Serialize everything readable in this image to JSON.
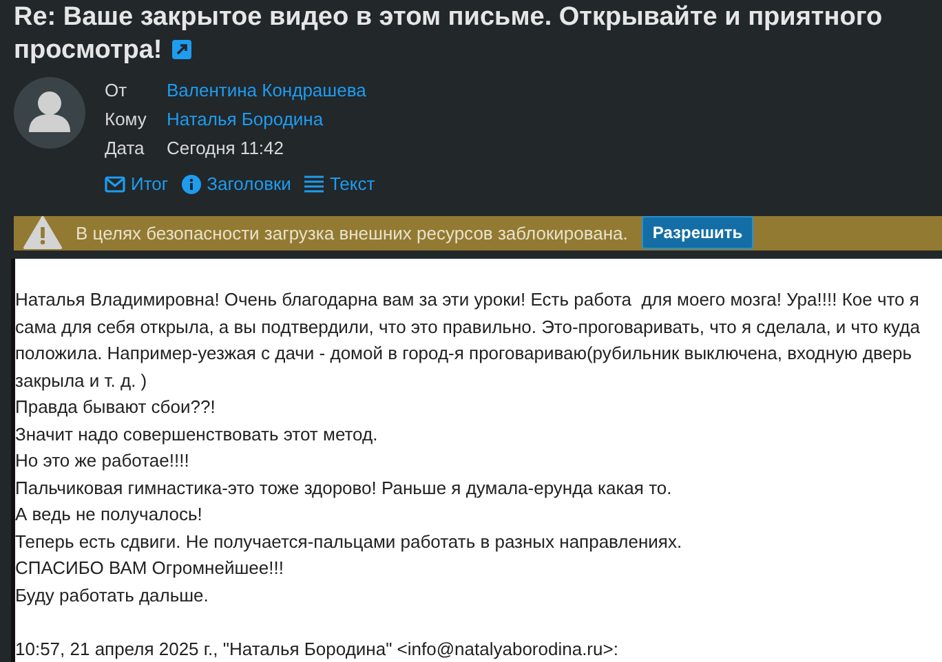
{
  "subject_lines": [
    "Re: Ваше закрытое видео в этом письме. Открывайте и приятного",
    "просмотра!"
  ],
  "header": {
    "fields": [
      {
        "label": "От",
        "value": "Валентина Кондрашева",
        "kind": "link"
      },
      {
        "label": "Кому",
        "value": "Наталья Бородина",
        "kind": "link"
      },
      {
        "label": "Дата",
        "value": "Сегодня 11:42",
        "kind": "text"
      }
    ],
    "views": [
      {
        "label": "Итог",
        "kind": "mail"
      },
      {
        "label": "Заголовки",
        "kind": "info"
      },
      {
        "label": "Текст",
        "kind": "lines"
      }
    ]
  },
  "banner": {
    "message": "В целях безопасности загрузка внешних ресурсов заблокирована.",
    "button": "Разрешить"
  },
  "body": [
    "Наталья Владимировна! Очень благодарна вам за эти уроки! Есть работа  для моего мозга! Ура!!!! Кое что я сама для себя открыла, а вы подтвердили, что это правильно. Это-проговаривать, что я сделала, и что куда положила. Например-уезжая с дачи - домой в город-я проговариваю(рубильник выключена, входную дверь закрыла и т. д. )",
    "Правда бывают сбои??!",
    "Значит надо совершенствовать этот метод.",
    "Но это же работае!!!!",
    "Пальчиковая гимнастика-это тоже здорово! Раньше я думала-ерунда какая то.",
    "А ведь не получалось!",
    "Теперь есть сдвиги. Не получается-пальцами работать в разных направлениях.",
    "СПАСИБО ВАМ Огромнейшее!!!",
    "Буду работать дальше."
  ],
  "quote_header": "10:57, 21 апреля 2025 г., \"Наталья Бородина\" <info@natalyaborodina.ru>:"
}
